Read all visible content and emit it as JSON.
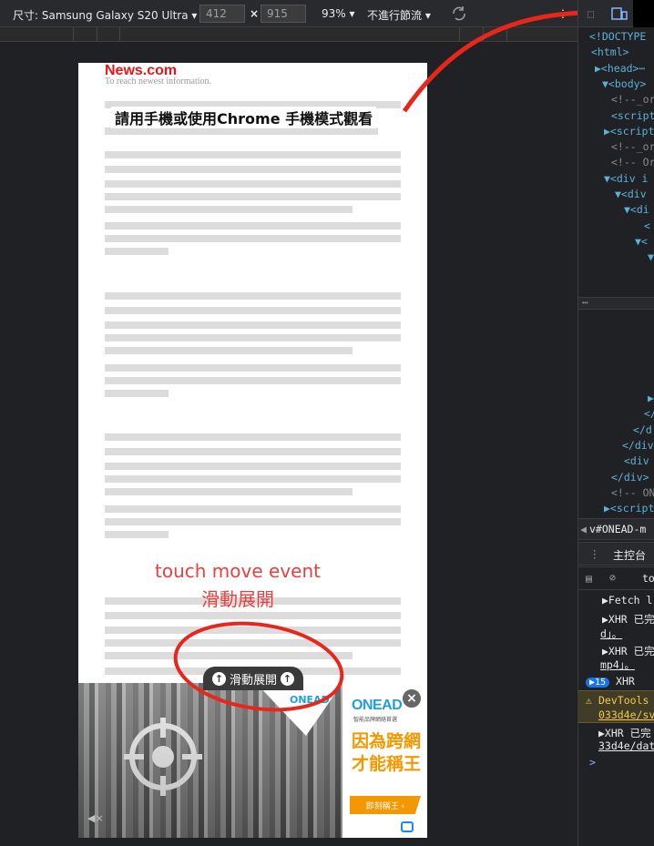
{
  "toolbar": {
    "device_label": "尺寸: Samsung Galaxy S20 Ultra",
    "width_value": "412",
    "height_value": "915",
    "times": "×",
    "zoom": "93%",
    "throttle": "不進行節流",
    "more": "⋮"
  },
  "page": {
    "logo": "News.com",
    "tagline": "To reach newest information.",
    "headline": "請用手機或使用Chrome 手機模式觀看"
  },
  "annotation": {
    "line1": "touch move event",
    "line2": "滑動展開"
  },
  "ad": {
    "expand_label": "滑動展開",
    "close": "×",
    "mute": "◀×",
    "brand_small": "ONEAD",
    "brand": "ONEAD",
    "brand_sub": "智能品牌網絡首選",
    "slogan_line1": "因為跨網",
    "slogan_line2": "才能稱王",
    "cta": "即刻稱王 ›"
  },
  "devtools": {
    "elements": [
      {
        "text": "<!DOCTYPE",
        "cls": "tag"
      },
      {
        "text": "<html>",
        "cls": "tag"
      },
      {
        "text": "▶<head>⋯",
        "cls": "tag"
      },
      {
        "text": "▼<body>",
        "cls": "tag"
      },
      {
        "text": "<!--_or",
        "cls": "cmt"
      },
      {
        "text": "<script",
        "cls": "tag"
      },
      {
        "text": "▶<script",
        "cls": "tag"
      },
      {
        "text": "<!--_or",
        "cls": "cmt"
      },
      {
        "text": "<!-- Or",
        "cls": "cmt"
      },
      {
        "text": "▼<div i",
        "cls": "tag"
      },
      {
        "text": "▼<div",
        "cls": "tag"
      },
      {
        "text": "▼<di",
        "cls": "tag"
      },
      {
        "text": "<",
        "cls": "tag"
      },
      {
        "text": "▼<",
        "cls": "tag"
      },
      {
        "text": "▼",
        "cls": "tag"
      }
    ],
    "elements_bottom": [
      {
        "text": "▶",
        "cls": "tag"
      },
      {
        "text": "</",
        "cls": "tag"
      },
      {
        "text": "</d",
        "cls": "tag"
      },
      {
        "text": "</div",
        "cls": "tag"
      },
      {
        "text": "<div",
        "cls": "tag"
      },
      {
        "text": "</div>",
        "cls": "tag"
      },
      {
        "text": "<!-- ON",
        "cls": "cmt"
      },
      {
        "text": "▶<script",
        "cls": "tag"
      }
    ],
    "breadcrumb": "v#ONEAD-m",
    "console_tab": "主控台",
    "context": "top",
    "log": [
      {
        "text": "▶Fetch l",
        "link": false
      },
      {
        "text": "▶XHR 已完",
        "link": false
      },
      {
        "text": "d」。",
        "link": true
      },
      {
        "text": "▶XHR 已完",
        "link": false
      },
      {
        "text": "mp4」。",
        "link": true
      }
    ],
    "group_count": "15",
    "group_label": "XHR",
    "warning_text": "DevTools",
    "warning_link": "033d4e/sv",
    "last_log": "▶XHR 已完",
    "last_link": "33d4e/dat",
    "prompt": ">"
  }
}
